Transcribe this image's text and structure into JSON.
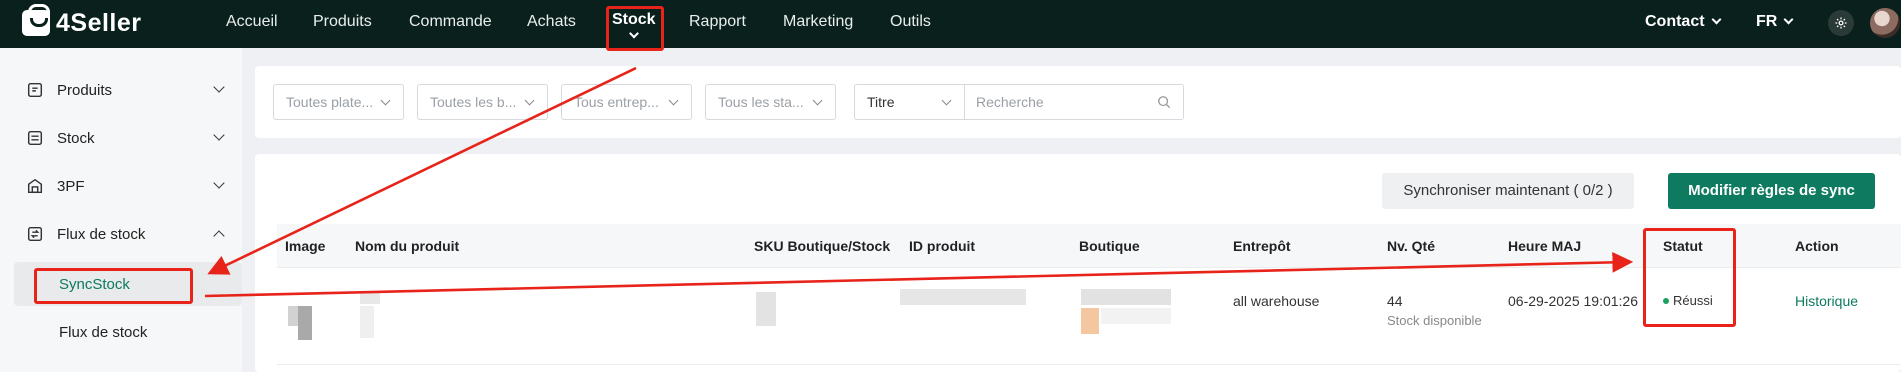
{
  "brand": {
    "name": "4Seller"
  },
  "nav": {
    "items": [
      "Accueil",
      "Produits",
      "Commande",
      "Achats",
      "Stock",
      "Rapport",
      "Marketing",
      "Outils"
    ],
    "active": "Stock",
    "contact": "Contact",
    "language": "FR"
  },
  "sidebar": {
    "items": [
      {
        "label": "Produits",
        "icon": "product-tag-icon",
        "expanded": false
      },
      {
        "label": "Stock",
        "icon": "stock-list-icon",
        "expanded": false
      },
      {
        "label": "3PF",
        "icon": "warehouse-icon",
        "expanded": false
      },
      {
        "label": "Flux de stock",
        "icon": "stock-flow-icon",
        "expanded": true
      }
    ],
    "subitems": [
      {
        "label": "SyncStock",
        "active": true
      },
      {
        "label": "Flux de stock",
        "active": false
      }
    ]
  },
  "filters": {
    "platforms": "Toutes plate...",
    "shops": "Toutes les b...",
    "warehouses": "Tous entrep...",
    "statuses": "Tous les sta...",
    "field": "Titre",
    "search_placeholder": "Recherche"
  },
  "actions": {
    "sync_now": "Synchroniser maintenant ( 0/2 )",
    "edit_rules": "Modifier règles de sync"
  },
  "table": {
    "columns": [
      "Image",
      "Nom du produit",
      "SKU Boutique/Stock",
      "ID produit",
      "Boutique",
      "Entrepôt",
      "Nv. Qté",
      "Heure MAJ",
      "Statut",
      "Action"
    ],
    "rows": [
      {
        "warehouse": "all warehouse",
        "qty": "44",
        "qty_note": "Stock disponible",
        "updated": "06-29-2025 19:01:26",
        "status": "Réussi",
        "action": "Historique"
      }
    ]
  },
  "colors": {
    "brand": "#0e7a5f",
    "nav_bg": "#09201c",
    "highlight": "#e8231a",
    "success": "#19a15f"
  }
}
